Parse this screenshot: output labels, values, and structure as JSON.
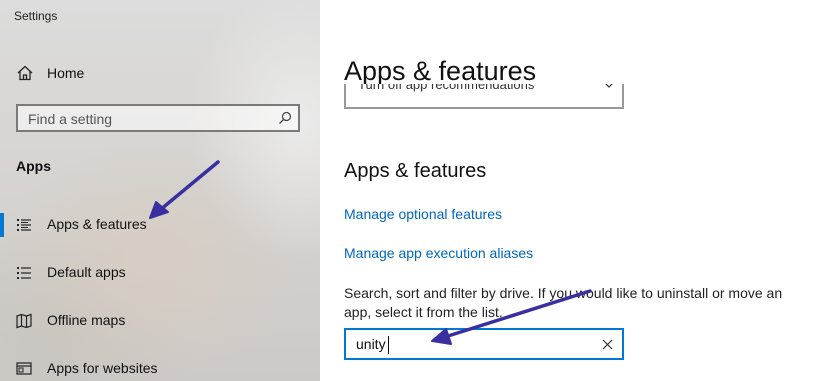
{
  "window": {
    "title": "Settings"
  },
  "sidebar": {
    "home_label": "Home",
    "search_placeholder": "Find a setting",
    "section_heading": "Apps",
    "items": [
      {
        "label": "Apps & features",
        "icon": "apps-features-icon",
        "selected": true
      },
      {
        "label": "Default apps",
        "icon": "default-apps-icon",
        "selected": false
      },
      {
        "label": "Offline maps",
        "icon": "offline-maps-icon",
        "selected": false
      },
      {
        "label": "Apps for websites",
        "icon": "apps-for-websites-icon",
        "selected": false
      }
    ]
  },
  "main": {
    "page_title": "Apps & features",
    "dropdown_value": "Turn off app recommendations",
    "sub_heading": "Apps & features",
    "links": [
      {
        "label": "Manage optional features"
      },
      {
        "label": "Manage app execution aliases"
      }
    ],
    "description": "Search, sort and filter by drive. If you would like to uninstall or move an app, select it from the list.",
    "filter_value": "unity"
  },
  "colors": {
    "accent": "#0078d4",
    "link": "#0067c0",
    "annotation_arrow": "#3a2fa0"
  }
}
